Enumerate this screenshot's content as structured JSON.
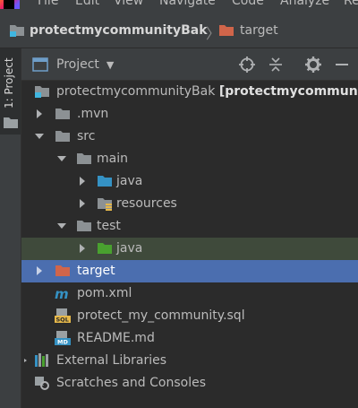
{
  "menubar": {
    "items": [
      "File",
      "Edit",
      "View",
      "Navigate",
      "Code",
      "Analyze",
      "Re"
    ]
  },
  "breadcrumb": {
    "project": "protectmycommunityBak",
    "current": "target"
  },
  "side_strip": {
    "project_tab": "1: Project"
  },
  "panel": {
    "title": "Project"
  },
  "tree": {
    "root": {
      "name": "protectmycommunityBak",
      "module": "[protectmycommuni"
    },
    "mvn": ".mvn",
    "src": "src",
    "main": "main",
    "main_java": "java",
    "resources": "resources",
    "test": "test",
    "test_java": "java",
    "target": "target",
    "pom": "pom.xml",
    "sql": "protect_my_community.sql",
    "readme": "README.md",
    "external": "External Libraries",
    "scratches": "Scratches and Consoles"
  },
  "colors": {
    "folder": "#6e7275",
    "source_folder": "#3592c4",
    "test_folder": "#49a12f",
    "excluded_folder": "#d0654a",
    "selection": "#4b6eaf",
    "highlight": "#3f4a3b"
  }
}
